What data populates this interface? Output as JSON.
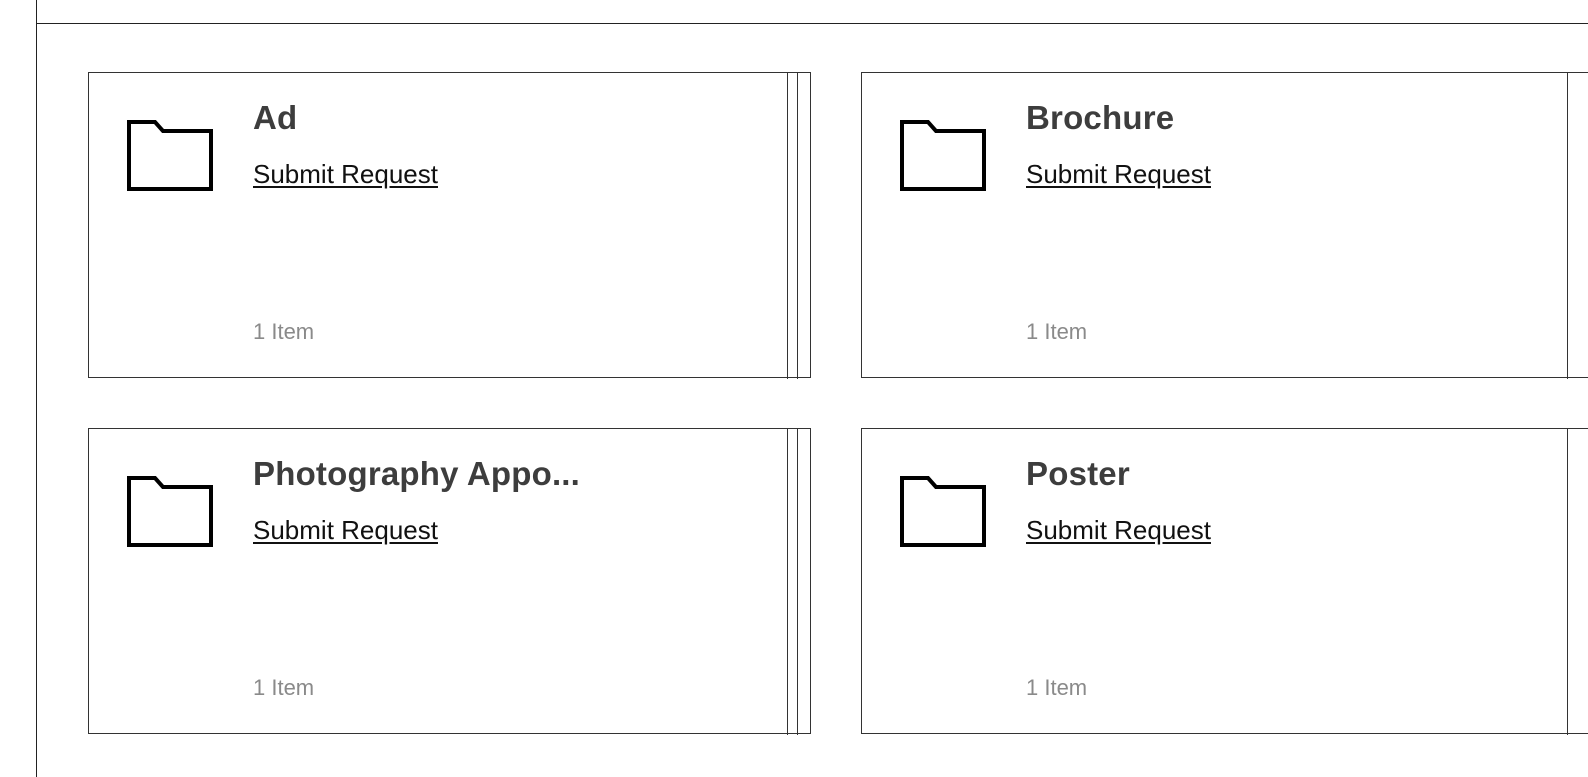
{
  "categories": [
    {
      "title": "Ad",
      "link_label": "Submit Request",
      "count_label": "1 Item"
    },
    {
      "title": "Brochure",
      "link_label": "Submit Request",
      "count_label": "1 Item"
    },
    {
      "title": "Photography Appo...",
      "link_label": "Submit Request",
      "count_label": "1 Item"
    },
    {
      "title": "Poster",
      "link_label": "Submit Request",
      "count_label": "1 Item"
    }
  ],
  "icons": {
    "folder": "folder-icon"
  }
}
